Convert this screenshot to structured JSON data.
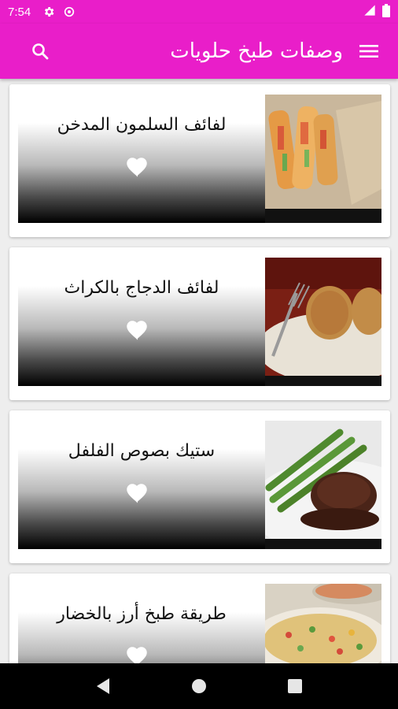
{
  "status_bar": {
    "time": "7:54",
    "icons": [
      "settings-icon",
      "data-saver-icon",
      "signal-icon",
      "battery-icon"
    ]
  },
  "app_bar": {
    "title": "وصفات طبخ حلويات",
    "menu_icon": "menu-icon",
    "search_icon": "search-icon",
    "color": "#e91ec9"
  },
  "recipes": [
    {
      "title": "لفائف السلمون المدخن",
      "image": "salmon-rolls-photo",
      "favorite_icon": "heart-icon"
    },
    {
      "title": "لفائف الدجاج بالكراث",
      "image": "chicken-leek-rolls-photo",
      "favorite_icon": "heart-icon"
    },
    {
      "title": "ستيك بصوص الفلفل",
      "image": "pepper-sauce-steak-photo",
      "favorite_icon": "heart-icon"
    },
    {
      "title": "طريقة طبخ أرز بالخضار",
      "image": "vegetable-rice-photo",
      "favorite_icon": "heart-icon"
    }
  ],
  "nav_bar": {
    "icons": [
      "back-icon",
      "home-icon",
      "recents-icon"
    ]
  }
}
